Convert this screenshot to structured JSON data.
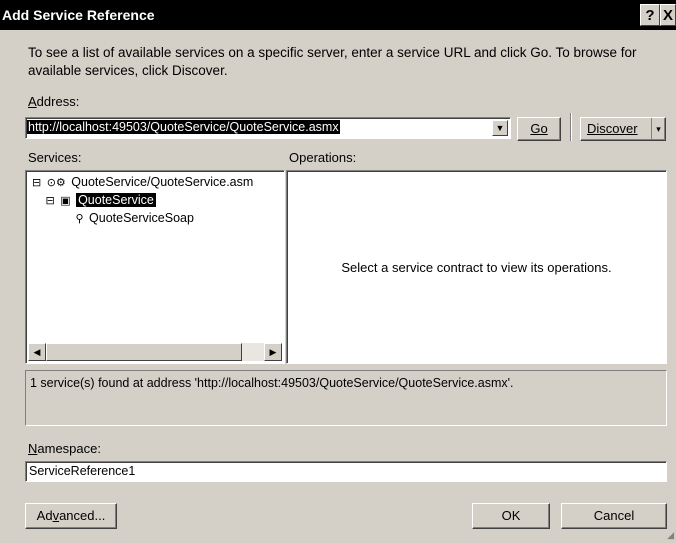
{
  "window": {
    "title": "Add Service Reference",
    "help_button": "?",
    "close_button": "X"
  },
  "intro_text": "To see a list of available services on a specific server, enter a service URL and click Go. To browse for available services, click Discover.",
  "address": {
    "label": "Address:",
    "value": "http://localhost:49503/QuoteService/QuoteService.asmx",
    "go_label": "Go",
    "discover_label": "Discover"
  },
  "services": {
    "label": "Services:",
    "tree": [
      {
        "label": "QuoteService/QuoteService.asm",
        "icon": "service-globe-icon",
        "expander": "⊟"
      },
      {
        "label": "QuoteService",
        "icon": "service-class-icon",
        "expander": "⊟",
        "selected": true
      },
      {
        "label": "QuoteServiceSoap",
        "icon": "contract-icon"
      }
    ]
  },
  "operations": {
    "label": "Operations:",
    "empty_message": "Select a service contract to view its operations."
  },
  "status_message": "1 service(s) found at address 'http://localhost:49503/QuoteService/QuoteService.asmx'.",
  "namespace": {
    "label": "Namespace:",
    "value": "ServiceReference1"
  },
  "buttons": {
    "advanced": "Advanced...",
    "ok": "OK",
    "cancel": "Cancel"
  }
}
